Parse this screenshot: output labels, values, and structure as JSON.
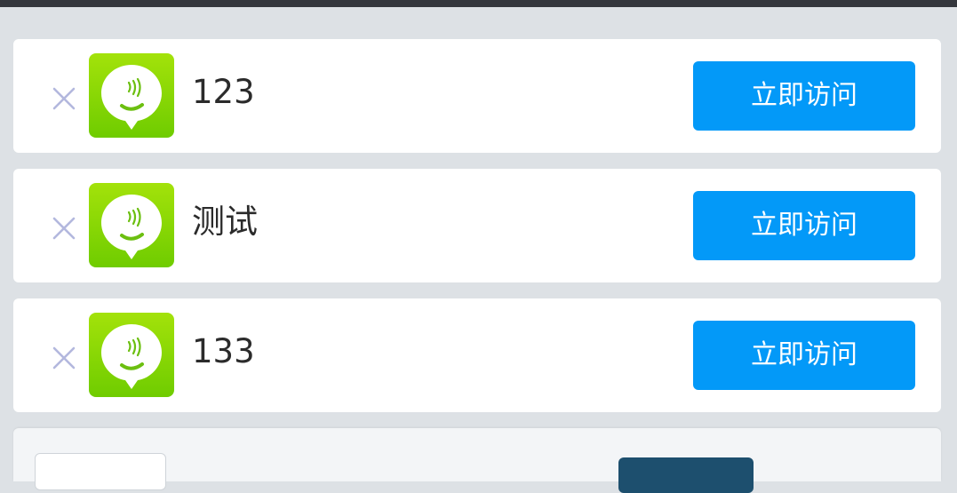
{
  "items": [
    {
      "name": "123",
      "button_label": "立即访问"
    },
    {
      "name": "测试",
      "button_label": "立即访问"
    },
    {
      "name": "133",
      "button_label": "立即访问"
    }
  ],
  "icons": {
    "close": "close-icon",
    "app": "app-logo-icon"
  },
  "colors": {
    "primary": "#0399f8",
    "background": "#dde1e5",
    "app_icon_green": "#8ed806"
  }
}
